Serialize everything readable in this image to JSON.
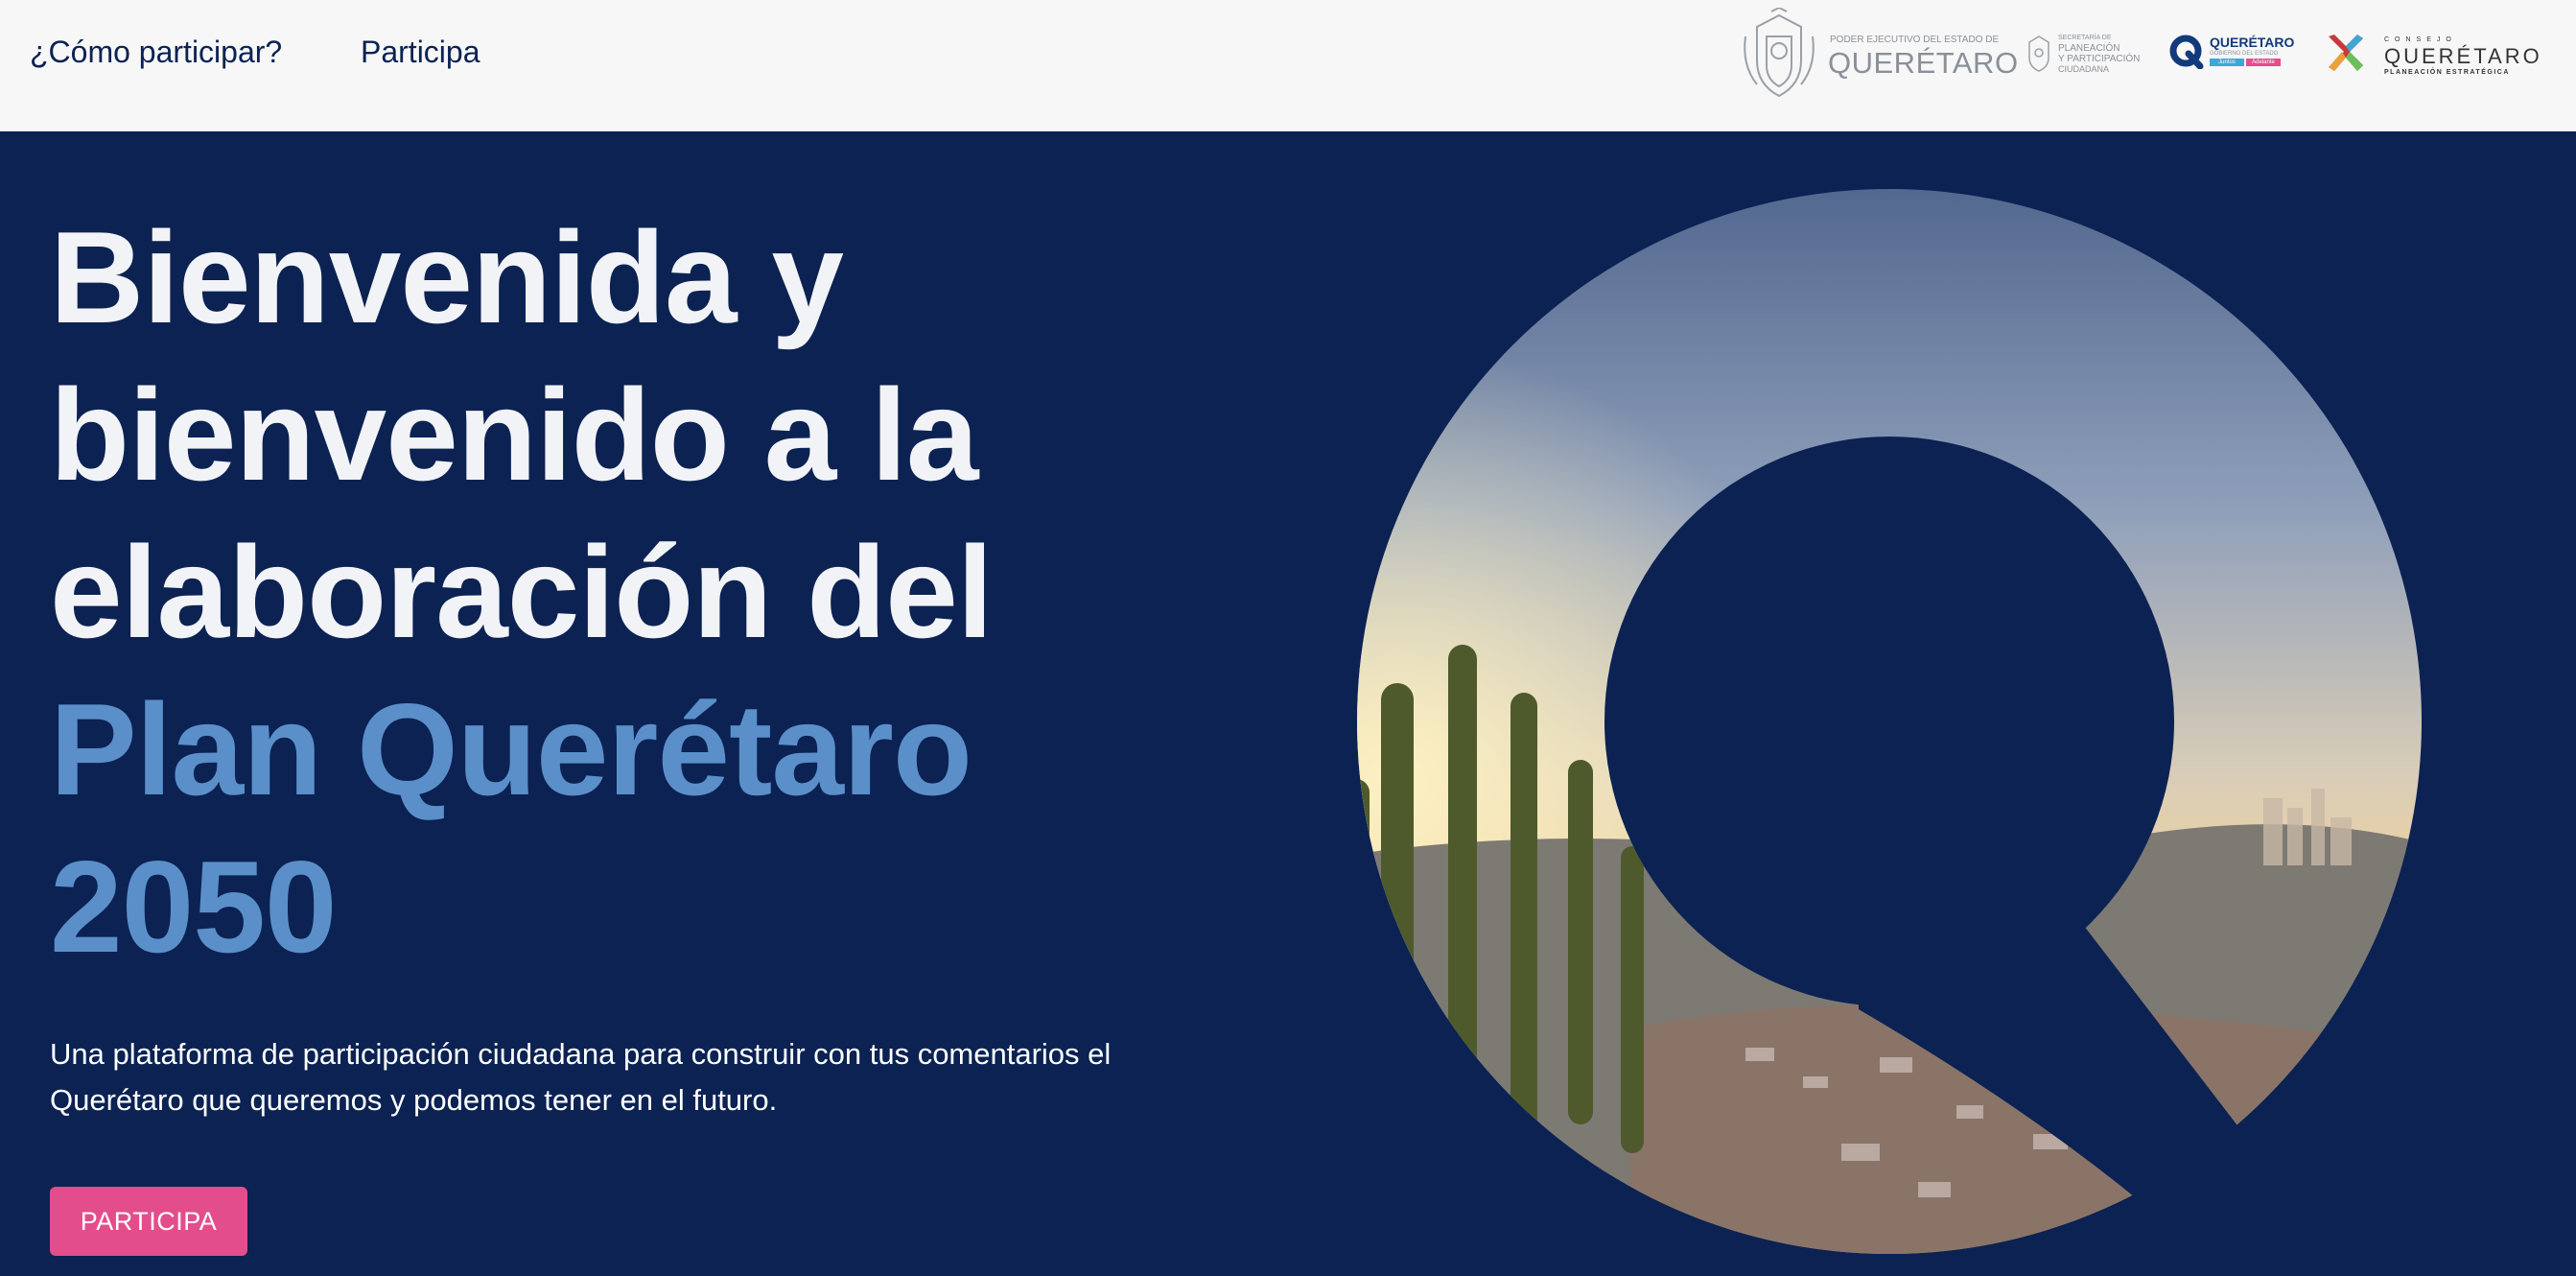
{
  "nav": {
    "how_to_participate": "¿Cómo participar?",
    "participate": "Participa"
  },
  "logos": {
    "state_government": {
      "small_text": "PODER EJECUTIVO DEL ESTADO DE",
      "big_text": "QUERÉTARO",
      "icon": "coat-of-arms-icon"
    },
    "secretaria": {
      "line1": "SECRETARÍA DE",
      "line2": "PLANEACIÓN",
      "line3": "Y PARTICIPACIÓN",
      "line4": "CIUDADANA",
      "icon": "crest-icon"
    },
    "gobierno": {
      "title": "QUERÉTARO",
      "subtitle": "GOBIERNO DEL ESTADO",
      "tag1": "Juntos",
      "tag2": "Adelante",
      "icon": "q-logo-icon"
    },
    "consejo": {
      "top": "CONSEJO",
      "main": "QUERÉTARO",
      "bottom": "PLANEACIÓN ESTRATÉGICA",
      "icon": "x-logo-icon"
    }
  },
  "hero": {
    "line1": "Bienvenida y",
    "line2": "bienvenido a la",
    "line3": "elaboración del",
    "accent1": "Plan Querétaro",
    "accent2": "2050",
    "subtitle": "Una plataforma de participación ciudadana para construir con tus comentarios el Querétaro que queremos y podemos tener en el futuro.",
    "cta": "PARTICIPA"
  },
  "colors": {
    "navy": "#0b2253",
    "accent_blue": "#5b8fc9",
    "cta_pink": "#e44d8c",
    "topbar": "#f7f7f7"
  }
}
